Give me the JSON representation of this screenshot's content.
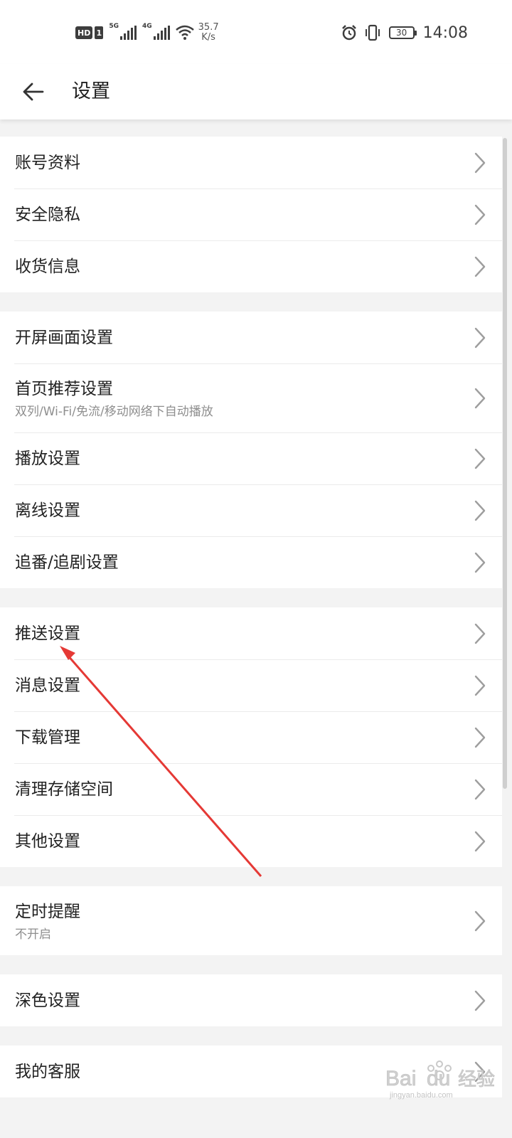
{
  "status_bar": {
    "hd": "HD",
    "sim": "1",
    "net_5g": "5G",
    "net_4g": "4G",
    "speed_value": "35.7",
    "speed_unit": "K/s",
    "battery": "30",
    "time": "14:08",
    "icons": [
      "alarm-icon",
      "vibrate-icon",
      "wifi-icon"
    ]
  },
  "header": {
    "title": "设置",
    "back_icon": "arrow-left-icon"
  },
  "groups": [
    [
      {
        "label": "账号资料"
      },
      {
        "label": "安全隐私"
      },
      {
        "label": "收货信息"
      }
    ],
    [
      {
        "label": "开屏画面设置"
      },
      {
        "label": "首页推荐设置",
        "sub": "双列/Wi-Fi/免流/移动网络下自动播放"
      },
      {
        "label": "播放设置"
      },
      {
        "label": "离线设置"
      },
      {
        "label": "追番/追剧设置"
      }
    ],
    [
      {
        "label": "推送设置"
      },
      {
        "label": "消息设置"
      },
      {
        "label": "下载管理"
      },
      {
        "label": "清理存储空间"
      },
      {
        "label": "其他设置"
      }
    ],
    [
      {
        "label": "定时提醒",
        "sub": "不开启"
      }
    ],
    [
      {
        "label": "深色设置"
      }
    ],
    [
      {
        "label": "我的客服"
      }
    ]
  ],
  "colors": {
    "annotation_arrow": "#e53935",
    "background": "#f3f3f3",
    "chevron": "#9e9e9e"
  },
  "watermark": {
    "text": "Bai du 经验",
    "url_text": "jingyan.baidu.com"
  }
}
